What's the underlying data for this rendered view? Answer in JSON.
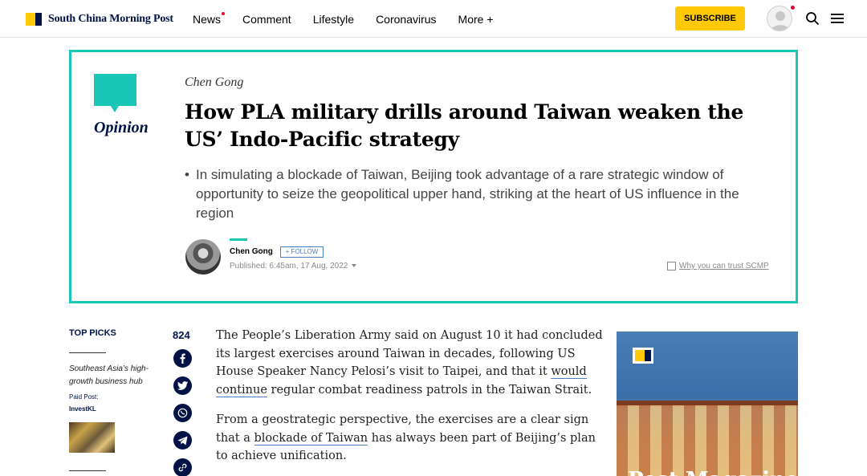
{
  "header": {
    "logo_text": "South China Morning Post",
    "nav": [
      "News",
      "Comment",
      "Lifestyle",
      "Coronavirus",
      "More +"
    ],
    "subscribe_label": "SUBSCRIBE"
  },
  "hero": {
    "section_label": "Opinion",
    "author": "Chen Gong",
    "headline": "How PLA military drills around Taiwan weaken the US’ Indo-Pacific strategy",
    "summary_bullet": "•",
    "summary": "In simulating a blockade of Taiwan, Beijing took advantage of a rare strategic window of opportunity to seize the geopolitical upper hand, striking at the heart of US influence in the region",
    "byline_name": "Chen Gong",
    "follow_label": "+ FOLLOW",
    "published": "Published: 6:45am, 17 Aug, 2022",
    "trust_link": "Why you can trust SCMP"
  },
  "top_picks": {
    "heading": "TOP PICKS",
    "item_title": "Southeast Asia’s high-growth business hub",
    "paid_label": "Paid Post:",
    "sponsor": "InvestKL"
  },
  "share": {
    "count": "824",
    "icons": [
      "facebook-icon",
      "twitter-icon",
      "whatsapp-icon",
      "telegram-icon",
      "link-icon"
    ]
  },
  "article": {
    "p1_a": "The People’s Liberation Army said on August 10 it had concluded its largest exercises around Taiwan in decades, following US House Speaker Nancy Pelosi’s visit to Taipei, and that it ",
    "p1_link": "would continue",
    "p1_b": " regular combat readiness patrols in the Taiwan Strait.",
    "p2_a": "From a geostrategic perspective, the exercises are a clear sign that a ",
    "p2_link": "blockade of Taiwan",
    "p2_b": " has always been part of Beijing’s plan to achieve unification."
  },
  "ad": {
    "text": "Post Magazine"
  },
  "colors": {
    "teal": "#1ac7b6",
    "navy": "#001246",
    "yellow": "#ffca05",
    "red": "#e4002b"
  }
}
